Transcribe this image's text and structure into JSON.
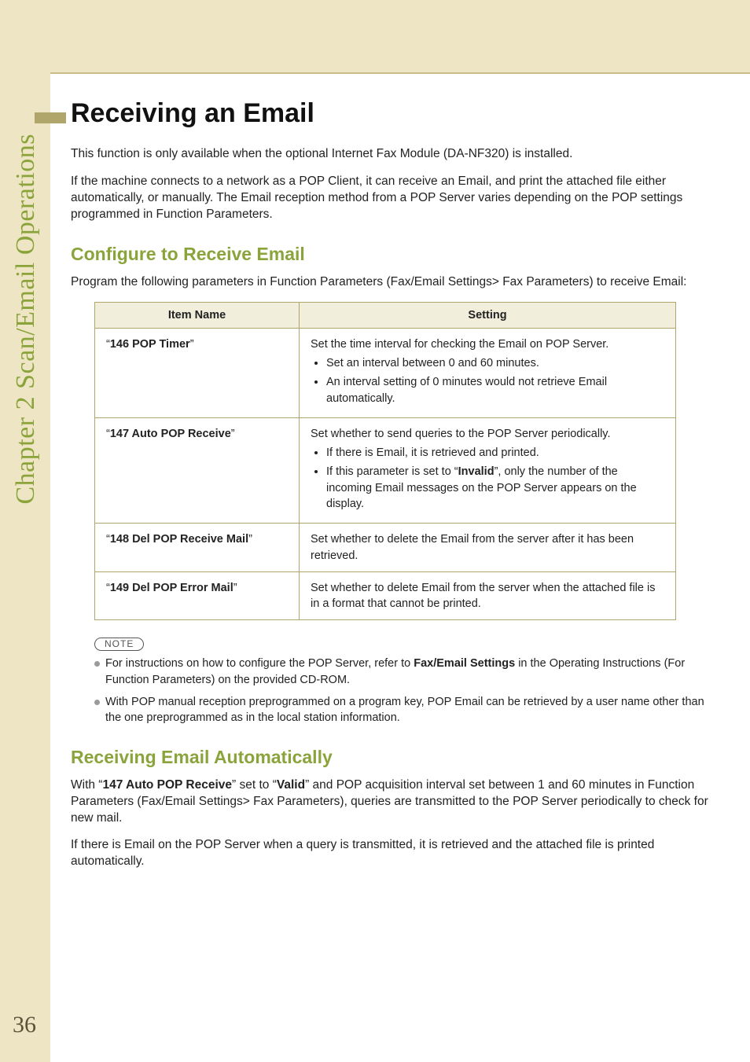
{
  "side_label": "Chapter 2  Scan/Email Operations",
  "page_number": "36",
  "h1": "Receiving an Email",
  "intro_p1": "This function is only available when the optional Internet Fax Module (DA-NF320) is installed.",
  "intro_p2": "If the machine connects to a network as a POP Client, it can receive an Email, and print the attached file either automatically, or manually. The Email reception method from a POP Server varies depending on the POP settings programmed in Function Parameters.",
  "h2_configure": "Configure to Receive Email",
  "configure_p": "Program the following parameters in Function Parameters (Fax/Email Settings> Fax Parameters) to receive Email:",
  "table": {
    "headers": {
      "col1": "Item Name",
      "col2": "Setting"
    },
    "rows": [
      {
        "item": "146 POP Timer",
        "lead": "Set the time interval for checking the Email on POP Server.",
        "bullets": [
          "Set an interval between 0 and 60 minutes.",
          "An interval setting of 0 minutes would not retrieve Email automatically."
        ]
      },
      {
        "item": "147 Auto POP Receive",
        "lead": "Set whether to send queries to the POP Server periodically.",
        "bullets_mixed": {
          "b1": "If there is Email, it is retrieved and printed.",
          "b2_pre": "If this parameter is set to “",
          "b2_bold": "Invalid",
          "b2_post": "”, only the number of the incoming Email messages on the POP Server appears on the display."
        }
      },
      {
        "item": "148 Del POP Receive Mail",
        "lead": "Set whether to delete the Email from the server after it has been retrieved."
      },
      {
        "item": "149 Del POP Error Mail",
        "lead": "Set whether to delete Email from the server when the attached file is in a format that cannot be printed."
      }
    ]
  },
  "note_label": "NOTE",
  "notes": {
    "n1_pre": "For instructions on how to configure the POP Server, refer to ",
    "n1_bold": "Fax/Email Settings",
    "n1_post": " in the Operating Instructions (For Function Parameters) on the provided CD-ROM.",
    "n2": "With POP manual reception preprogrammed on a program key, POP Email can be retrieved by a user name other than the one preprogrammed as in the local station information."
  },
  "h2_auto": "Receiving Email Automatically",
  "auto_p1_pre": "With “",
  "auto_p1_b1": "147 Auto POP Receive",
  "auto_p1_mid": "” set to “",
  "auto_p1_b2": "Valid",
  "auto_p1_post": "” and POP acquisition interval set between 1 and 60 minutes in Function Parameters (Fax/Email Settings> Fax Parameters), queries are transmitted to the POP Server periodically to check for new mail.",
  "auto_p2": "If there is Email on the POP Server when a query is transmitted, it is retrieved and the attached file is printed automatically."
}
